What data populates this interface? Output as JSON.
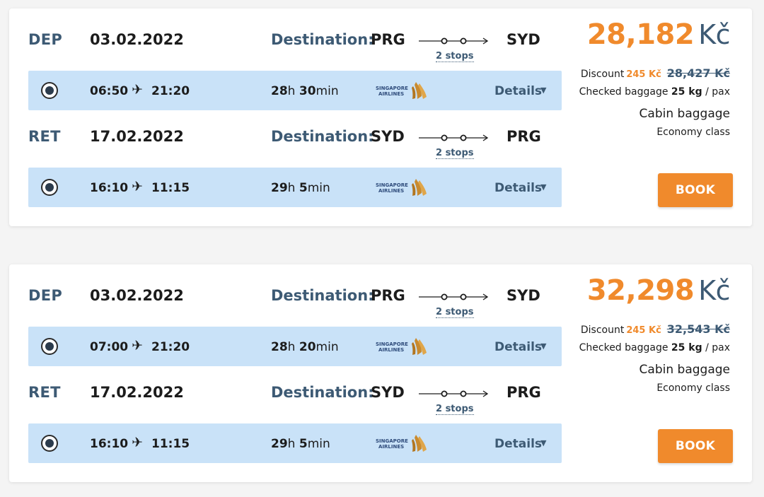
{
  "offers": [
    {
      "price": "28,182",
      "currency": "Kč",
      "discount_label": "Discount",
      "discount_amount": "245 Kč",
      "old_price": "28,427",
      "old_currency": "Kč",
      "baggage_prefix": "Checked baggage",
      "baggage_weight": "25 kg",
      "baggage_suffix": "/ pax",
      "cabin": "Cabin baggage",
      "class": "Economy class",
      "book_label": "BOOK",
      "legs": [
        {
          "code": "DEP",
          "date": "03.02.2022",
          "dest_label": "Destination:",
          "from": "PRG",
          "to": "SYD",
          "stops": "2 stops",
          "dep_time": "06:50",
          "arr_time": "21:20",
          "duration_h": "28",
          "duration_h_unit": "h",
          "duration_m": "30",
          "duration_m_unit": "min",
          "airline_line1": "SINGAPORE",
          "airline_line2": "AIRLINES",
          "details_label": "Details"
        },
        {
          "code": "RET",
          "date": "17.02.2022",
          "dest_label": "Destination:",
          "from": "SYD",
          "to": "PRG",
          "stops": "2 stops",
          "dep_time": "16:10",
          "arr_time": "11:15",
          "duration_h": "29",
          "duration_h_unit": "h",
          "duration_m": "5",
          "duration_m_unit": "min",
          "airline_line1": "SINGAPORE",
          "airline_line2": "AIRLINES",
          "details_label": "Details"
        }
      ]
    },
    {
      "price": "32,298",
      "currency": "Kč",
      "discount_label": "Discount",
      "discount_amount": "245 Kč",
      "old_price": "32,543",
      "old_currency": "Kč",
      "baggage_prefix": "Checked baggage",
      "baggage_weight": "25 kg",
      "baggage_suffix": "/ pax",
      "cabin": "Cabin baggage",
      "class": "Economy class",
      "book_label": "BOOK",
      "legs": [
        {
          "code": "DEP",
          "date": "03.02.2022",
          "dest_label": "Destination:",
          "from": "PRG",
          "to": "SYD",
          "stops": "2 stops",
          "dep_time": "07:00",
          "arr_time": "21:20",
          "duration_h": "28",
          "duration_h_unit": "h",
          "duration_m": "20",
          "duration_m_unit": "min",
          "airline_line1": "SINGAPORE",
          "airline_line2": "AIRLINES",
          "details_label": "Details"
        },
        {
          "code": "RET",
          "date": "17.02.2022",
          "dest_label": "Destination:",
          "from": "SYD",
          "to": "PRG",
          "stops": "2 stops",
          "dep_time": "16:10",
          "arr_time": "11:15",
          "duration_h": "29",
          "duration_h_unit": "h",
          "duration_m": "5",
          "duration_m_unit": "min",
          "airline_line1": "SINGAPORE",
          "airline_line2": "AIRLINES",
          "details_label": "Details"
        }
      ]
    }
  ],
  "colors": {
    "accent": "#f08a2c",
    "navy": "#3d5a74",
    "row_bg": "#c9e2f8"
  },
  "icons": {
    "plane": "plane-icon",
    "radio": "radio-selected-icon",
    "caret": "caret-down-icon",
    "route": "route-stops-icon",
    "airline": "singapore-airlines-logo"
  }
}
